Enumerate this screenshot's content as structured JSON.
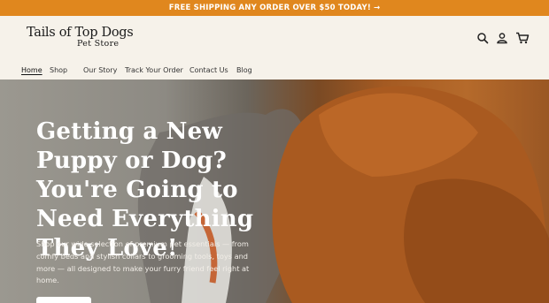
{
  "announcement": {
    "text": "FREE SHIPPING ANY ORDER OVER $50 TODAY!",
    "arrow": "→",
    "bg": "#e0871e"
  },
  "header": {
    "logo_line1": "Tails of Top Dogs",
    "logo_line2": "Pet Store",
    "icons": [
      "search-icon",
      "account-icon",
      "cart-icon"
    ]
  },
  "nav": {
    "items": [
      {
        "label": "Home",
        "active": true
      },
      {
        "label": "Shop"
      },
      {
        "label": "Our Story"
      },
      {
        "label": "Track Your Order"
      },
      {
        "label": "Contact Us"
      },
      {
        "label": "Blog"
      }
    ]
  },
  "hero": {
    "heading": "Getting a New Puppy or Dog? You're Going to Need Everything They Love!",
    "body": "Shop our wide selection of premium pet essentials — from comfy beds and stylish collars to grooming tools, toys and more — all designed to make your furry friend feel right at home."
  }
}
